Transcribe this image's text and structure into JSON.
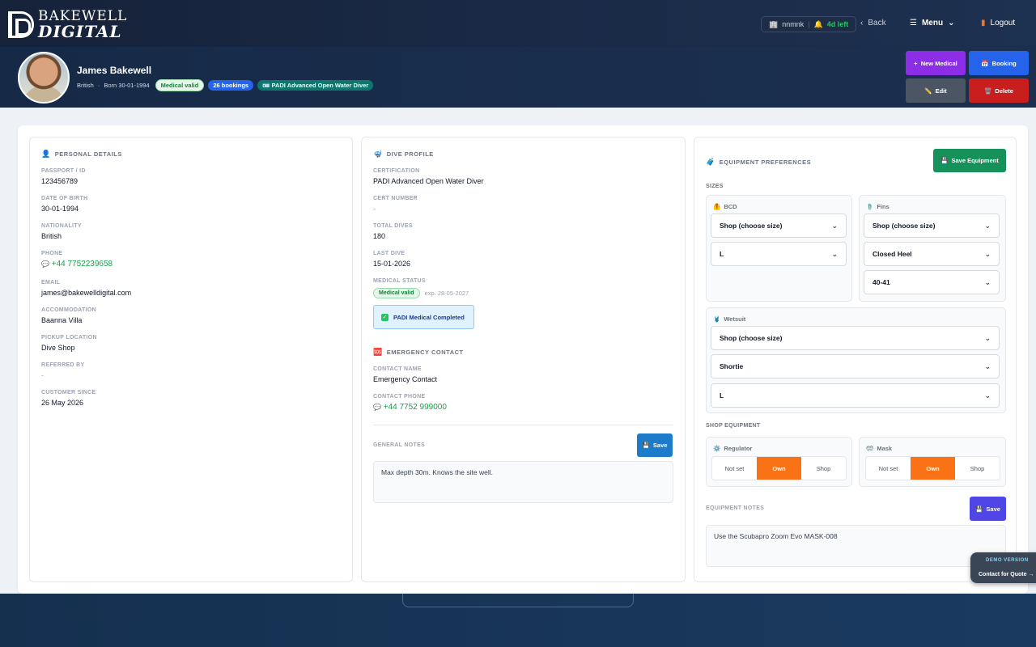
{
  "nav": {
    "logo_line1": "BAKEWELL",
    "logo_line2": "DIGITAL",
    "user_icon": "building-icon",
    "user_name": "nnmnk",
    "alert_icon": "bell-icon",
    "days_left": "4d left",
    "back_label": "Back",
    "menu_label": "Menu",
    "logout_label": "Logout"
  },
  "profile": {
    "name": "James Bakewell",
    "nationality": "British",
    "born": "Born 30-01-1994",
    "badge_medical": "Medical valid",
    "badge_bookings": "26 bookings",
    "badge_cert": "PADI Advanced Open Water Diver",
    "actions": {
      "new_medical": "New Medical",
      "booking": "Booking",
      "edit": "Edit",
      "delete": "Delete"
    }
  },
  "personal": {
    "title": "PERSONAL DETAILS",
    "fields": [
      {
        "label": "PASSPORT / ID",
        "value": "123456789"
      },
      {
        "label": "DATE OF BIRTH",
        "value": "30-01-1994"
      },
      {
        "label": "NATIONALITY",
        "value": "British"
      },
      {
        "label": "PHONE",
        "value": "+44 7752239658"
      },
      {
        "label": "EMAIL",
        "value": "james@bakewelldigital.com"
      },
      {
        "label": "ACCOMMODATION",
        "value": "Baanna Villa"
      },
      {
        "label": "PICKUP LOCATION",
        "value": "Dive Shop"
      },
      {
        "label": "REFERRED BY",
        "value": "-"
      },
      {
        "label": "CUSTOMER SINCE",
        "value": "26 May 2026"
      }
    ]
  },
  "dive": {
    "title": "DIVE PROFILE",
    "fields": [
      {
        "label": "CERTIFICATION",
        "value": "PADI Advanced Open Water Diver"
      },
      {
        "label": "CERT NUMBER",
        "value": "-"
      },
      {
        "label": "TOTAL DIVES",
        "value": "180"
      },
      {
        "label": "LAST DIVE",
        "value": "15-01-2026"
      }
    ],
    "medical_label": "MEDICAL STATUS",
    "medical_badge": "Medical valid",
    "medical_exp": "exp. 28-05-2027",
    "medical_completed": "PADI Medical Completed",
    "emergency_title": "EMERGENCY CONTACT",
    "contact_name_label": "CONTACT NAME",
    "contact_name": "Emergency Contact",
    "contact_phone_label": "CONTACT PHONE",
    "contact_phone": "+44 7752 999000",
    "notes_label": "GENERAL NOTES",
    "notes_save": "Save",
    "notes_text": "Max depth 30m. Knows the site well."
  },
  "equipment": {
    "title": "EQUIPMENT PREFERENCES",
    "save_label": "Save Equipment",
    "sizes_label": "SIZES",
    "bcd": {
      "title": "BCD",
      "source": "Shop (choose size)",
      "size": "L"
    },
    "fins": {
      "title": "Fins",
      "source": "Shop (choose size)",
      "type": "Closed Heel",
      "size": "40-41"
    },
    "wetsuit": {
      "title": "Wetsuit",
      "source": "Shop (choose size)",
      "style": "Shortie",
      "size": "L"
    },
    "shop_label": "SHOP EQUIPMENT",
    "regulator": {
      "title": "Regulator",
      "options": [
        "Not set",
        "Own",
        "Shop"
      ],
      "selected": "Own"
    },
    "mask": {
      "title": "Mask",
      "options": [
        "Not set",
        "Own",
        "Shop"
      ],
      "selected": "Own"
    },
    "notes_label": "EQUIPMENT NOTES",
    "notes_save": "Save",
    "notes_text": "Use the Scubapro Zoom Evo MASK-008"
  },
  "demo": {
    "label": "DEMO VERSION",
    "cta": "Contact for Quote →"
  },
  "colors": {
    "purple": "#8b2ee6",
    "blue": "#2563eb",
    "gray": "#4b5563",
    "red": "#c81e1e",
    "green": "#16a34a",
    "orange": "#f97316",
    "indigo": "#4f46e5",
    "sky": "#1d7bc9"
  }
}
